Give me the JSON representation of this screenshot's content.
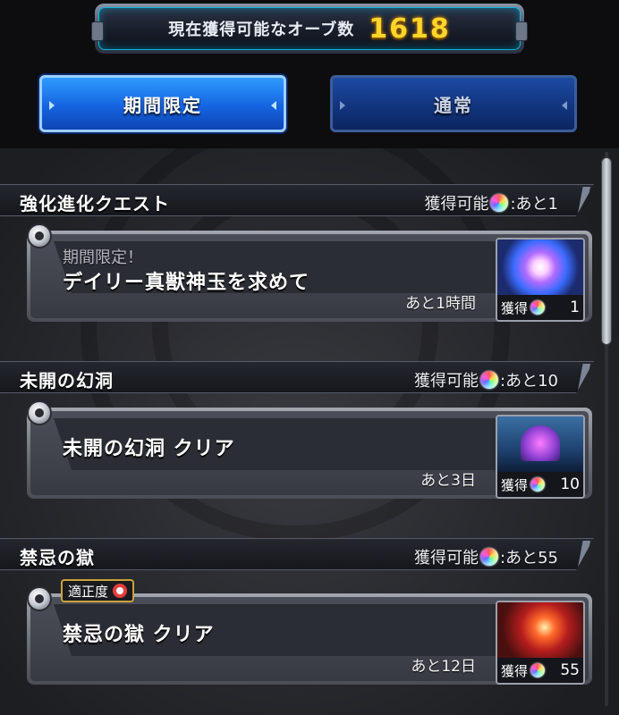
{
  "header": {
    "orb_label": "現在獲得可能なオーブ数",
    "orb_count": "1618",
    "tabs": [
      {
        "label": "期間限定",
        "active": true
      },
      {
        "label": "通常",
        "active": false
      }
    ]
  },
  "sections": [
    {
      "title": "強化進化クエスト",
      "available_label": "獲得可能",
      "remaining_label": ":あと1",
      "card": {
        "subtitle": "期間限定！",
        "title": "デイリー真獣神玉を求めて",
        "time_left": "あと1時間",
        "reward_label": "獲得",
        "reward_amount": "1",
        "art": "gold-tama-icon"
      }
    },
    {
      "title": "未開の幻洞",
      "available_label": "獲得可能",
      "remaining_label": ":あと10",
      "card": {
        "title": "未開の幻洞 クリア",
        "time_left": "あと3日",
        "reward_label": "獲得",
        "reward_amount": "10",
        "art": "shrine-icon"
      }
    },
    {
      "title": "禁忌の獄",
      "available_label": "獲得可能",
      "remaining_label": ":あと55",
      "card": {
        "badge": "適正度",
        "title": "禁忌の獄 クリア",
        "time_left": "あと12日",
        "reward_label": "獲得",
        "reward_amount": "55",
        "art": "hell-gate-icon"
      }
    }
  ],
  "colors": {
    "orb_count": "#ffd52a",
    "tab_active": "#1564e0",
    "tab_inactive": "#12357f"
  }
}
